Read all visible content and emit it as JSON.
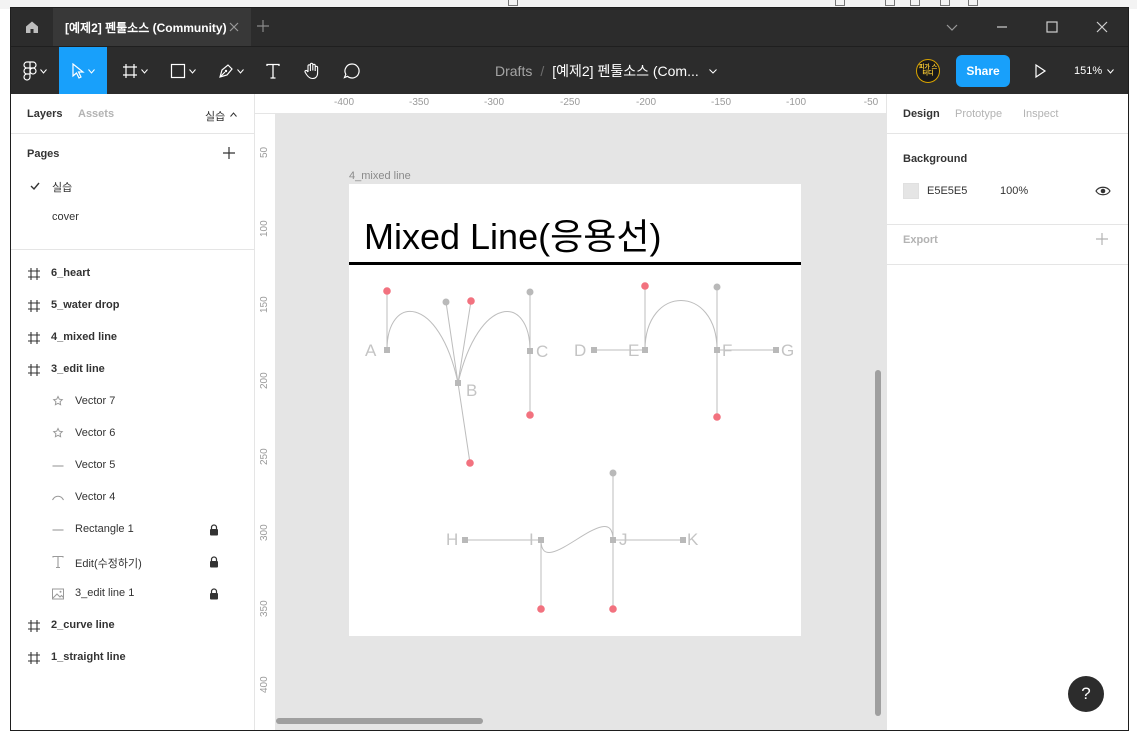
{
  "titlebar": {
    "tab_title": "[예제2] 펜툴소스 (Community)"
  },
  "toolbar": {
    "breadcrumb_root": "Drafts",
    "breadcrumb_sep": "/",
    "file_name": "[예제2] 펜툴소스 (Com...",
    "share_label": "Share",
    "zoom_label": "151%",
    "avatar_text": "피가 스터디",
    "tools": [
      "main-menu",
      "move",
      "frame",
      "shape",
      "pen",
      "text",
      "hand",
      "comment"
    ]
  },
  "left_panel": {
    "tab_layers": "Layers",
    "tab_assets": "Assets",
    "current_page_label": "실습",
    "pages_title": "Pages",
    "pages": [
      {
        "label": "실습",
        "selected": true
      },
      {
        "label": "cover",
        "selected": false
      }
    ],
    "layers": [
      {
        "name": "6_heart",
        "type": "frame",
        "locked": false
      },
      {
        "name": "5_water drop",
        "type": "frame",
        "locked": false
      },
      {
        "name": "4_mixed line",
        "type": "frame",
        "locked": false
      },
      {
        "name": "3_edit line",
        "type": "frame",
        "locked": false
      },
      {
        "name": "Vector 7",
        "type": "star",
        "locked": false
      },
      {
        "name": "Vector 6",
        "type": "star",
        "locked": false
      },
      {
        "name": "Vector 5",
        "type": "line",
        "locked": false
      },
      {
        "name": "Vector 4",
        "type": "curve",
        "locked": false
      },
      {
        "name": "Rectangle 1",
        "type": "line",
        "locked": true
      },
      {
        "name": "Edit(수정하기)",
        "type": "text",
        "locked": true
      },
      {
        "name": "3_edit line 1",
        "type": "image",
        "locked": true
      },
      {
        "name": "2_curve line",
        "type": "frame",
        "locked": false
      },
      {
        "name": "1_straight line",
        "type": "frame",
        "locked": false
      }
    ]
  },
  "canvas": {
    "ruler_top": [
      "-400",
      "-350",
      "-300",
      "-250",
      "-200",
      "-150",
      "-100",
      "-50"
    ],
    "ruler_left": [
      "50",
      "100",
      "150",
      "200",
      "250",
      "300",
      "350",
      "400"
    ],
    "frame_label": "4_mixed line",
    "frame_title": "Mixed Line(응용선)",
    "point_labels": [
      "A",
      "B",
      "C",
      "D",
      "E",
      "F",
      "G",
      "H",
      "I",
      "J",
      "K"
    ]
  },
  "right_panel": {
    "tab_design": "Design",
    "tab_prototype": "Prototype",
    "tab_inspect": "Inspect",
    "background_title": "Background",
    "background_hex": "E5E5E5",
    "background_opacity": "100%",
    "export_title": "Export",
    "help_label": "?"
  },
  "colors": {
    "accent": "#18a0fb",
    "toolbar_bg": "#2c2c2c",
    "canvas_bg": "#e5e5e5",
    "handle_red": "#f2727f",
    "anchor_gray": "#b9b9b9"
  }
}
